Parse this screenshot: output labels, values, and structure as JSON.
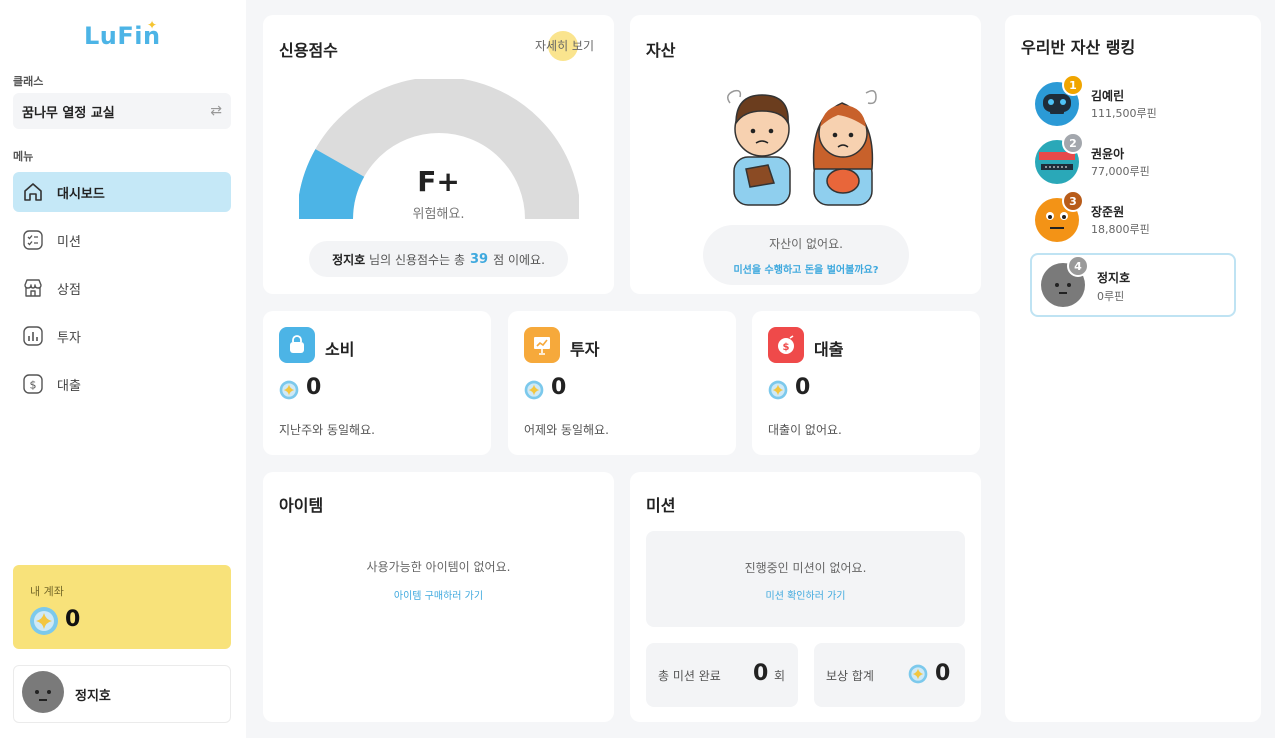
{
  "brand": {
    "logo_text": "LuFin"
  },
  "sidebar": {
    "class_caption": "클래스",
    "class_name": "꿈나무 열정 교실",
    "menu_caption": "메뉴",
    "items": [
      {
        "label": "대시보드",
        "icon": "home-icon",
        "active": true
      },
      {
        "label": "미션",
        "icon": "checklist-icon",
        "active": false
      },
      {
        "label": "상점",
        "icon": "store-icon",
        "active": false
      },
      {
        "label": "투자",
        "icon": "chart-icon",
        "active": false
      },
      {
        "label": "대출",
        "icon": "dollar-icon",
        "active": false
      }
    ],
    "account": {
      "caption": "내 계좌",
      "amount": "0"
    },
    "user": {
      "name": "정지호"
    }
  },
  "credit": {
    "title": "신용점수",
    "more_label": "자세히 보기",
    "grade": "F+",
    "grade_desc": "위험해요.",
    "score": 39,
    "score_max": 100,
    "msg_name": "정지호",
    "msg_mid": "님의 신용점수는 총",
    "msg_end": "점 이에요."
  },
  "asset": {
    "title": "자산",
    "empty": "자산이 없어요.",
    "link": "미션을 수행하고 돈을 벌어볼까요?"
  },
  "stats": [
    {
      "title": "소비",
      "value": "0",
      "desc": "지난주와 동일해요.",
      "icon": "shopping-bag-icon",
      "color": "#4cb4e6"
    },
    {
      "title": "투자",
      "value": "0",
      "desc": "어제와 동일해요.",
      "icon": "presentation-chart-icon",
      "color": "#f6a93b"
    },
    {
      "title": "대출",
      "value": "0",
      "desc": "대출이 없어요.",
      "icon": "money-bag-icon",
      "color": "#ef4a4a"
    }
  ],
  "items": {
    "title": "아이템",
    "empty": "사용가능한 아이템이 없어요.",
    "link": "아이템 구매하러 가기"
  },
  "mission": {
    "title": "미션",
    "empty": "진행중인 미션이 없어요.",
    "link": "미션 확인하러 가기",
    "total_label": "총 미션 완료",
    "total_value": "0",
    "total_unit": "회",
    "reward_label": "보상 합계",
    "reward_value": "0"
  },
  "ranking": {
    "title": "우리반 자산 랭킹",
    "entries": [
      {
        "rank": "1",
        "name": "김예린",
        "amount": "111,500루핀",
        "badge_color": "#f0a500"
      },
      {
        "rank": "2",
        "name": "권윤아",
        "amount": "77,000루핀",
        "badge_color": "#a3a7ad"
      },
      {
        "rank": "3",
        "name": "장준원",
        "amount": "18,800루핀",
        "badge_color": "#b85c1a"
      }
    ],
    "me": {
      "rank": "4",
      "name": "정지호",
      "amount": "0루핀",
      "badge_color": "#9a9a9a"
    }
  }
}
